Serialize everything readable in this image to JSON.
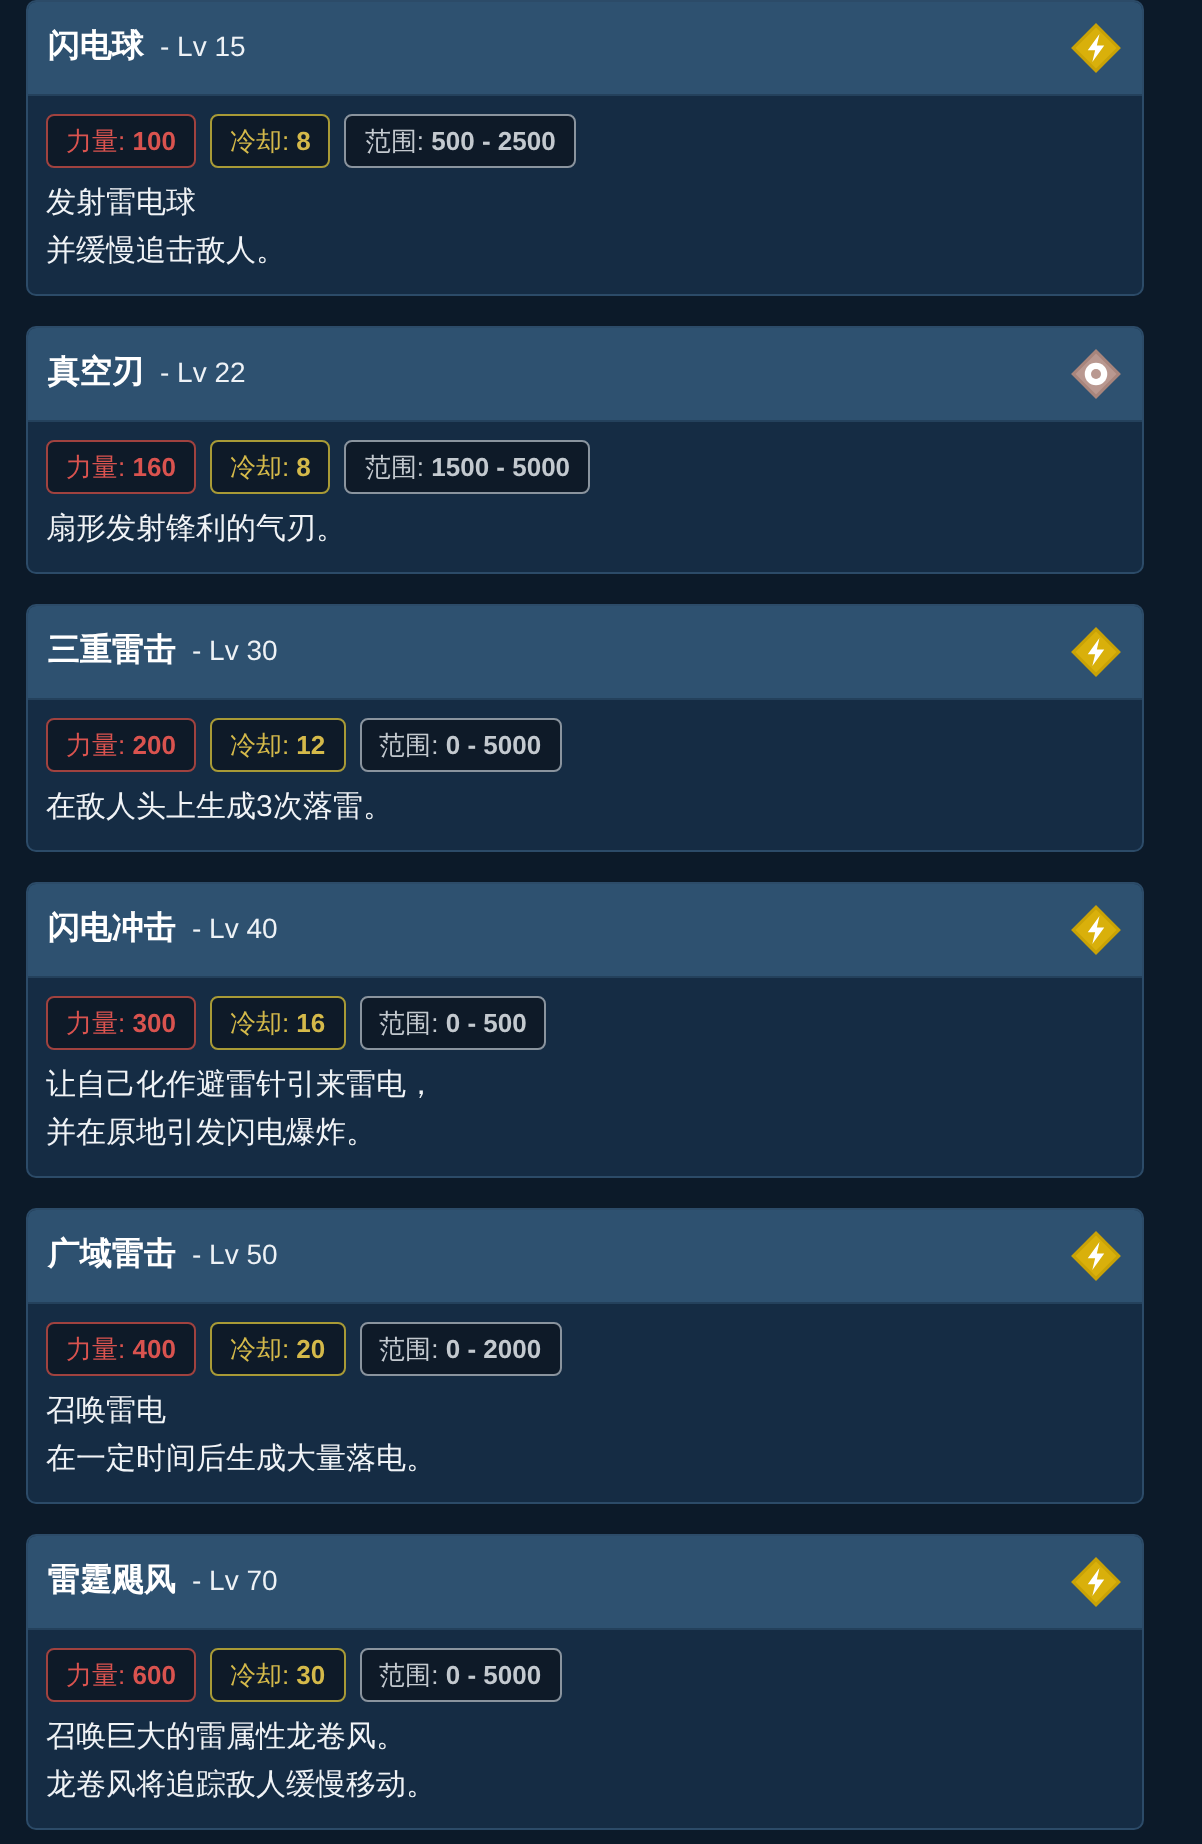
{
  "skills": [
    {
      "name": "闪电球",
      "level": "- Lv 15",
      "kind": "lightning",
      "stats": [
        {
          "kind": "power",
          "text": "力量: **100**"
        },
        {
          "kind": "cooldown",
          "text": "冷却: **8**"
        },
        {
          "kind": "range",
          "text": "范围: **500 - 2500**"
        }
      ],
      "description": [
        "发射雷电球",
        "并缓慢追击敌人。"
      ]
    },
    {
      "name": "真空刃",
      "level": "- Lv 22",
      "kind": "target",
      "stats": [
        {
          "kind": "power",
          "text": "力量: **160**"
        },
        {
          "kind": "cooldown",
          "text": "冷却: **8**"
        },
        {
          "kind": "range",
          "text": "范围: **1500 - 5000**"
        }
      ],
      "description": [
        "扇形发射锋利的气刃。"
      ]
    },
    {
      "name": "三重雷击",
      "level": "- Lv 30",
      "kind": "lightning",
      "stats": [
        {
          "kind": "power",
          "text": "力量: **200**"
        },
        {
          "kind": "cooldown",
          "text": "冷却: **12**"
        },
        {
          "kind": "range",
          "text": "范围: **0 - 5000**"
        }
      ],
      "description": [
        "在敌人头上生成3次落雷。"
      ]
    },
    {
      "name": "闪电冲击",
      "level": "- Lv 40",
      "kind": "lightning",
      "stats": [
        {
          "kind": "power",
          "text": "力量: **300**"
        },
        {
          "kind": "cooldown",
          "text": "冷却: **16**"
        },
        {
          "kind": "range",
          "text": "范围: **0 - 500**"
        }
      ],
      "description": [
        "让自己化作避雷针引来雷电，",
        "并在原地引发闪电爆炸。"
      ]
    },
    {
      "name": "广域雷击",
      "level": "- Lv 50",
      "kind": "lightning",
      "stats": [
        {
          "kind": "power",
          "text": "力量: **400**"
        },
        {
          "kind": "cooldown",
          "text": "冷却: **20**"
        },
        {
          "kind": "range",
          "text": "范围: **0 - 2000**"
        }
      ],
      "description": [
        "召唤雷电",
        "在一定时间后生成大量落电。"
      ]
    },
    {
      "name": "雷霆飓风",
      "level": "- Lv 70",
      "kind": "lightning",
      "stats": [
        {
          "kind": "power",
          "text": "力量: **600**"
        },
        {
          "kind": "cooldown",
          "text": "冷却: **30**"
        },
        {
          "kind": "range",
          "text": "范围: **0 - 5000**"
        }
      ],
      "description": [
        "召唤巨大的雷属性龙卷风。",
        "龙卷风将追踪敌人缓慢移动。"
      ]
    }
  ]
}
